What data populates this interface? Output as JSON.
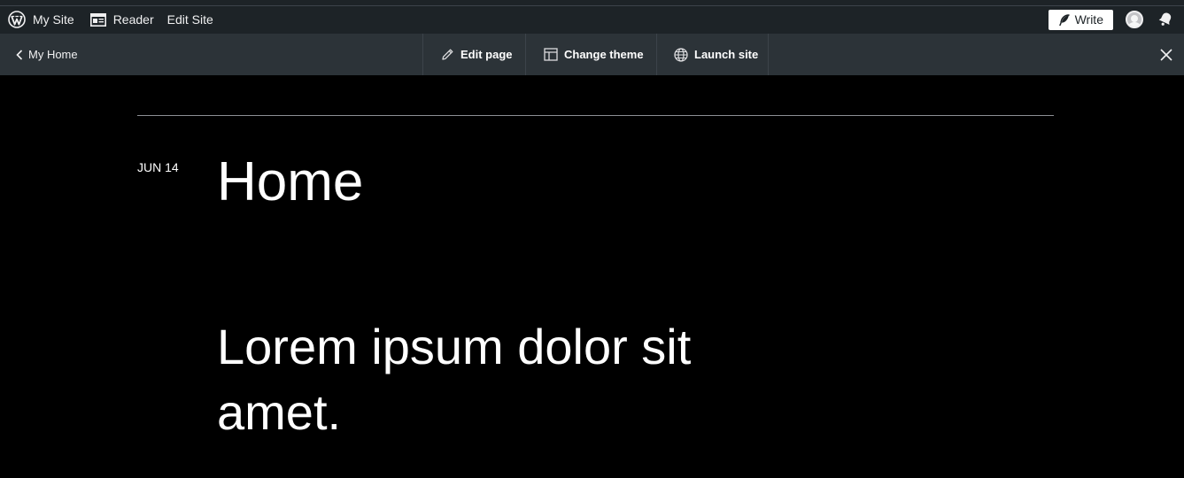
{
  "adminbar": {
    "logo_icon": "wordpress-icon",
    "my_site": "My Site",
    "reader": "Reader",
    "reader_icon": "reader-icon",
    "edit_site": "Edit Site",
    "write": "Write",
    "write_icon": "feather-icon",
    "avatar_icon": "avatar-icon",
    "notifications_icon": "bell-icon"
  },
  "previewbar": {
    "back_label": "My Home",
    "back_icon": "chevron-left-icon",
    "actions": [
      {
        "label": "Edit page",
        "icon": "pencil-icon"
      },
      {
        "label": "Change theme",
        "icon": "layout-icon"
      },
      {
        "label": "Launch site",
        "icon": "globe-icon"
      }
    ],
    "close_icon": "close-icon"
  },
  "post": {
    "date": "JUN 14",
    "title": "Home",
    "body": "Lorem ipsum dolor sit amet."
  },
  "colors": {
    "adminbar_bg": "#1d2327",
    "previewbar_bg": "#2c3338",
    "page_bg": "#000000",
    "text": "#ffffff"
  }
}
